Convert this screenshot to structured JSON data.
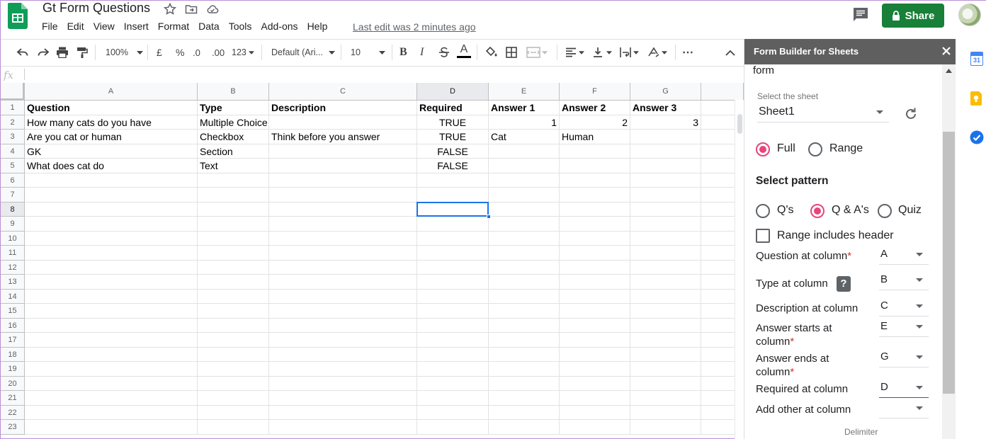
{
  "app": {
    "doc_title": "Gt Form Questions",
    "menu": [
      "File",
      "Edit",
      "View",
      "Insert",
      "Format",
      "Data",
      "Tools",
      "Add-ons",
      "Help"
    ],
    "last_edit": "Last edit was 2 minutes ago",
    "share_label": "Share"
  },
  "toolbar": {
    "zoom": "100%",
    "currency": "£",
    "percent": "%",
    "decimal_decrease": ".0",
    "decimal_increase": ".00",
    "more_formats": "123",
    "font": "Default (Ari...",
    "font_size": "10",
    "bold": "B",
    "italic": "I",
    "text_color": "A",
    "more": "⋯"
  },
  "formula_bar": {
    "fx": "fx",
    "value": ""
  },
  "sheet": {
    "columns": [
      "A",
      "B",
      "C",
      "D",
      "E",
      "F",
      "G"
    ],
    "rows": [
      "1",
      "2",
      "3",
      "4",
      "5",
      "6",
      "7",
      "8",
      "9",
      "10",
      "11",
      "12",
      "13",
      "14",
      "15",
      "16",
      "17",
      "18",
      "19",
      "20",
      "21",
      "22",
      "23"
    ],
    "header_row": [
      "Question",
      "Type",
      "Description",
      "Required",
      "Answer 1",
      "Answer 2",
      "Answer 3"
    ],
    "data_rows": [
      [
        "How many cats do you have",
        "Multiple Choice",
        "",
        "TRUE",
        "1",
        "2",
        "3"
      ],
      [
        "Are you cat or human",
        "Checkbox",
        "Think before you answer",
        "TRUE",
        "Cat",
        "Human",
        ""
      ],
      [
        "GK",
        "Section",
        "",
        "FALSE",
        "",
        "",
        ""
      ],
      [
        "What does cat do",
        "Text",
        "",
        "FALSE",
        "",
        "",
        ""
      ]
    ],
    "selected_cell": "D8"
  },
  "sidebar": {
    "title": "Form Builder for Sheets",
    "partial_heading": "form",
    "select_sheet_label": "Select the sheet",
    "sheet_value": "Sheet1",
    "scope_options": [
      "Full",
      "Range"
    ],
    "scope_selected": "Full",
    "select_pattern_label": "Select pattern",
    "pattern_options": [
      "Q's",
      "Q & A's",
      "Quiz"
    ],
    "pattern_selected": "Q & A's",
    "range_header_label": "Range includes header",
    "range_header_checked": false,
    "fields": [
      {
        "label": "Question at column",
        "required": true,
        "value": "A"
      },
      {
        "label": "Type at column",
        "required": false,
        "value": "B",
        "help": "?"
      },
      {
        "label": "Description at column",
        "required": false,
        "value": "C"
      },
      {
        "label_line1": "Answer starts at",
        "label_line2": "column",
        "required": true,
        "value": "E"
      },
      {
        "label_line1": "Answer ends at",
        "label_line2": "column",
        "required": true,
        "value": "G"
      },
      {
        "label": "Required at column",
        "required": false,
        "value": "D"
      },
      {
        "label": "Add other at column",
        "required": false,
        "value": ""
      }
    ],
    "required_mark": "*",
    "delimiter_label": "Delimiter"
  },
  "rail": {
    "calendar_day": "31"
  },
  "colors": {
    "sheets_green": "#0f9d58",
    "share_green": "#188038",
    "radio_pink": "#e8457a",
    "selection_blue": "#1a73e8",
    "sidebar_header": "#5f5f5f"
  }
}
